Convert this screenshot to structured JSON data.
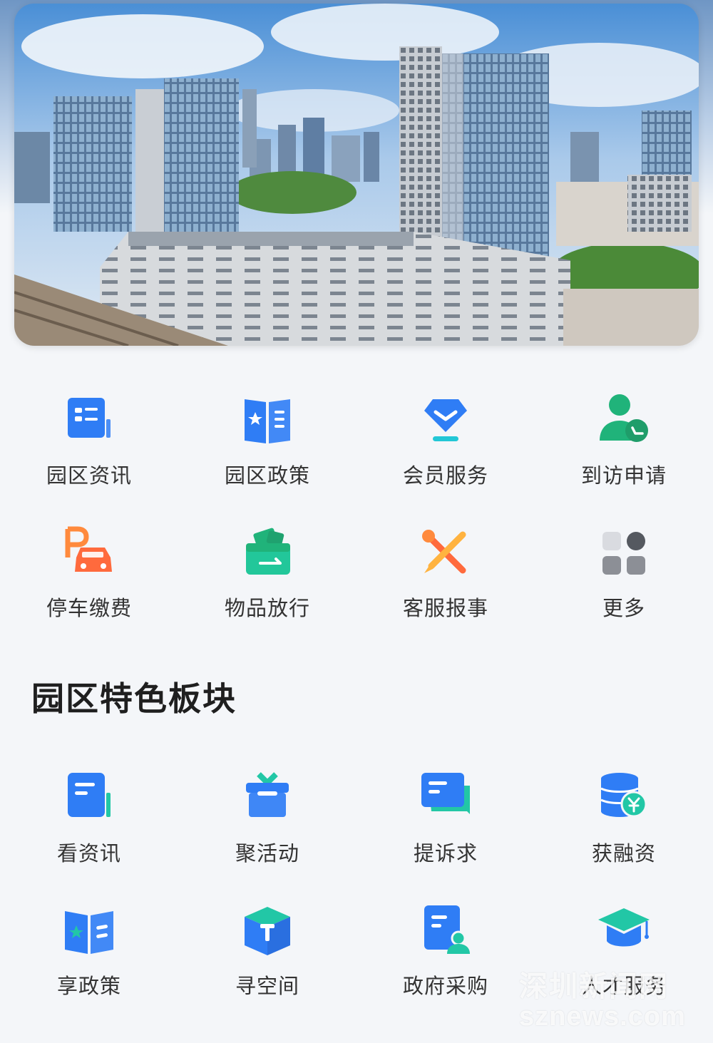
{
  "banner": {
    "description_icon": "city-skyline-photo"
  },
  "quick_services": {
    "items": [
      {
        "label": "园区资讯",
        "icon": "news-card-icon"
      },
      {
        "label": "园区政策",
        "icon": "policy-book-icon"
      },
      {
        "label": "会员服务",
        "icon": "member-diamond-icon"
      },
      {
        "label": "到访申请",
        "icon": "visitor-person-icon"
      },
      {
        "label": "停车缴费",
        "icon": "parking-car-icon"
      },
      {
        "label": "物品放行",
        "icon": "wallet-release-icon"
      },
      {
        "label": "客服报事",
        "icon": "tools-icon"
      },
      {
        "label": "更多",
        "icon": "more-grid-icon"
      }
    ]
  },
  "featured": {
    "title": "园区特色板块",
    "items": [
      {
        "label": "看资讯",
        "icon": "news-card-icon"
      },
      {
        "label": "聚活动",
        "icon": "gift-box-icon"
      },
      {
        "label": "提诉求",
        "icon": "chat-bubble-icon"
      },
      {
        "label": "获融资",
        "icon": "coin-stack-icon"
      },
      {
        "label": "享政策",
        "icon": "policy-book-icon"
      },
      {
        "label": "寻空间",
        "icon": "cube-icon"
      },
      {
        "label": "政府采购",
        "icon": "purchase-doc-icon"
      },
      {
        "label": "人才服务",
        "icon": "graduation-cap-icon"
      }
    ]
  },
  "watermark": {
    "cn": "深圳新闻网",
    "en": "sznews.com"
  },
  "colors": {
    "blue": "#2f7df5",
    "teal": "#22c7a6",
    "green": "#20b37a",
    "orange": "#ff8a3d",
    "gray": "#8c8f96",
    "background": "#f4f6f9"
  }
}
